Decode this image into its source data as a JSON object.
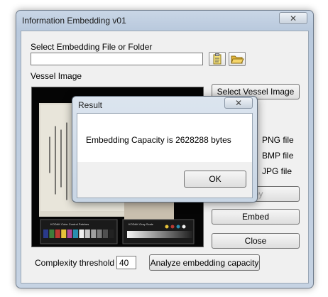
{
  "window": {
    "title": "Information Embedding v01",
    "close_glyph": "✕"
  },
  "file": {
    "label": "Select Embedding File or Folder",
    "value": ""
  },
  "vessel": {
    "label": "Vessel Image",
    "select_button": "Select Vessel Image",
    "chart_label_1": "KODAK Color Control Patches",
    "chart_label_2": "KODAK Gray Scale"
  },
  "formats": [
    "PNG file",
    "BMP file",
    "JPG file"
  ],
  "buttons": {
    "key": "Key",
    "embed": "Embed",
    "close": "Close",
    "analyze": "Analyze embedding capacity"
  },
  "threshold": {
    "label": "Complexity threshold",
    "value": "40"
  },
  "dialog": {
    "title": "Result",
    "close_glyph": "✕",
    "message": "Embedding Capacity is 2628288 bytes",
    "ok": "OK"
  },
  "colors": {
    "patches": [
      "#2a3a8a",
      "#3f7d3b",
      "#b83a32",
      "#e6c23a",
      "#b04a9a",
      "#2a8fb0",
      "#f0f0f0",
      "#c8c8c8",
      "#a0a0a0",
      "#7a7a7a",
      "#505050",
      "#222222"
    ],
    "gray_dots": [
      "#e6c23a",
      "#b83a32",
      "#2a8fb0",
      "#f0f0f0"
    ]
  }
}
